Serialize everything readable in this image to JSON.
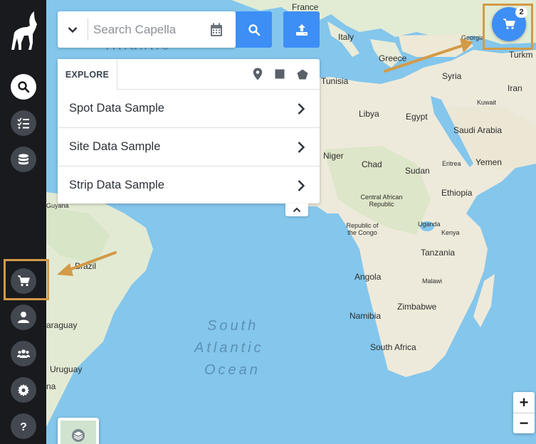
{
  "sidebar": {
    "items": [
      {
        "name": "search",
        "icon": "search-icon",
        "active": true
      },
      {
        "name": "tasks",
        "icon": "tasks-icon",
        "active": false
      },
      {
        "name": "database",
        "icon": "database-icon",
        "active": false
      },
      {
        "name": "cart",
        "icon": "cart-icon",
        "active": false
      },
      {
        "name": "user",
        "icon": "user-icon",
        "active": false
      },
      {
        "name": "team",
        "icon": "team-icon",
        "active": false
      },
      {
        "name": "settings",
        "icon": "gear-icon",
        "active": false
      },
      {
        "name": "help",
        "icon": "help-icon",
        "active": false
      }
    ]
  },
  "search": {
    "placeholder": "Search Capella"
  },
  "explore": {
    "tab_label": "EXPLORE",
    "tools": [
      "pin-icon",
      "rectangle-icon",
      "polygon-icon"
    ],
    "rows": [
      {
        "label": "Spot Data Sample"
      },
      {
        "label": "Site Data Sample"
      },
      {
        "label": "Strip Data Sample"
      }
    ]
  },
  "cart": {
    "count": "2"
  },
  "zoom": {
    "in_label": "+",
    "out_label": "−"
  },
  "map_labels": {
    "france": "France",
    "italy": "Italy",
    "georgia": "Georgia",
    "turkmen": "Turkm",
    "greece": "Greece",
    "tunisia": "Tunisia",
    "syria": "Syria",
    "iran": "Iran",
    "kuwait": "Kuwait",
    "libya": "Libya",
    "egypt": "Egypt",
    "saudi_arabia": "Saudi Arabia",
    "niger": "Niger",
    "chad": "Chad",
    "sudan": "Sudan",
    "eritrea": "Eritrea",
    "yemen": "Yemen",
    "guyana": "Guyana",
    "central_african_republic": "Central African Republic",
    "ethiopia": "Ethiopia",
    "republic_congo": "Republic of the Congo",
    "uganda": "Uganda",
    "kenya": "Kenya",
    "tanzania": "Tanzania",
    "brazil": "Brazil",
    "angola": "Angola",
    "malawi": "Malawi",
    "zimbabwe": "Zimbabwe",
    "namibia": "Namibia",
    "paraguay": "araguay",
    "south_africa": "South Africa",
    "uruguay": "Uruguay",
    "argentina": "na"
  },
  "ocean_labels": {
    "north_atlantic": "Atlantic",
    "south_line1": "South",
    "south_line2": "Atlantic",
    "south_line3": "Ocean"
  },
  "colors": {
    "accent": "#3d8ef5",
    "sidebar": "#181a1d",
    "annotation": "#d39a47",
    "water": "#84c6ec",
    "land": "#eeeadb"
  }
}
